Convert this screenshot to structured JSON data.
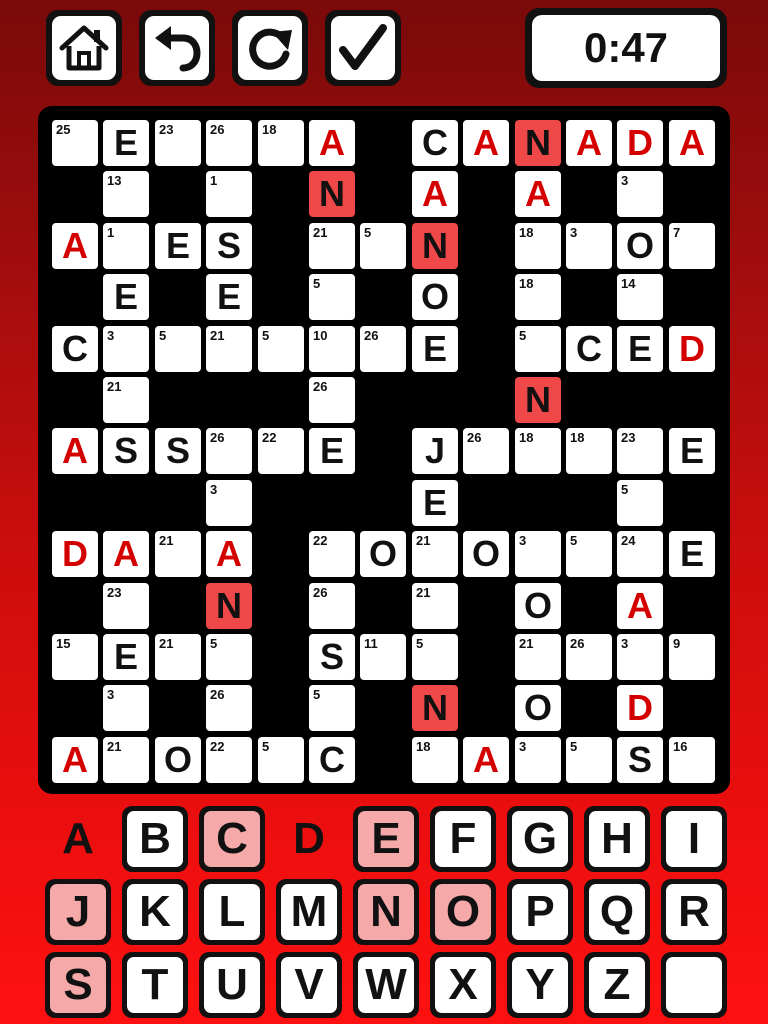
{
  "toolbar": {
    "home": "home-icon",
    "undo": "undo-icon",
    "restart": "restart-icon",
    "check": "check-icon"
  },
  "timer": "0:47",
  "grid": [
    [
      {
        "n": "25"
      },
      {
        "l": "E"
      },
      {
        "n": "23"
      },
      {
        "n": "26"
      },
      {
        "n": "18"
      },
      {
        "l": "A",
        "s": "red"
      },
      null,
      {
        "l": "C"
      },
      {
        "l": "A",
        "s": "red"
      },
      {
        "l": "N",
        "s": "fill"
      },
      {
        "l": "A",
        "s": "red"
      },
      {
        "l": "D",
        "s": "red"
      },
      {
        "l": "A",
        "s": "red"
      }
    ],
    [
      null,
      {
        "n": "13"
      },
      null,
      {
        "n": "1"
      },
      null,
      {
        "l": "N",
        "s": "fill"
      },
      null,
      {
        "l": "A",
        "s": "red"
      },
      null,
      {
        "l": "A",
        "s": "red"
      },
      null,
      {
        "n": "3"
      },
      null
    ],
    [
      {
        "l": "A",
        "s": "red"
      },
      {
        "n": "1"
      },
      {
        "l": "E"
      },
      {
        "l": "S"
      },
      null,
      {
        "n": "21"
      },
      {
        "n": "5"
      },
      {
        "l": "N",
        "s": "fill"
      },
      null,
      {
        "n": "18"
      },
      {
        "n": "3"
      },
      {
        "l": "O"
      },
      {
        "n": "7"
      }
    ],
    [
      null,
      {
        "l": "E"
      },
      null,
      {
        "l": "E"
      },
      null,
      {
        "n": "5"
      },
      null,
      {
        "l": "O"
      },
      null,
      {
        "n": "18"
      },
      null,
      {
        "n": "14"
      },
      null
    ],
    [
      {
        "l": "C"
      },
      {
        "n": "3"
      },
      {
        "n": "5"
      },
      {
        "n": "21"
      },
      {
        "n": "5"
      },
      {
        "n": "10"
      },
      {
        "n": "26"
      },
      {
        "l": "E"
      },
      null,
      {
        "n": "5"
      },
      {
        "l": "C"
      },
      {
        "l": "E"
      },
      {
        "l": "D",
        "s": "red"
      }
    ],
    [
      null,
      {
        "n": "21"
      },
      null,
      null,
      null,
      {
        "n": "26"
      },
      null,
      null,
      null,
      {
        "l": "N",
        "s": "fill"
      },
      null,
      null,
      null
    ],
    [
      {
        "l": "A",
        "s": "red"
      },
      {
        "l": "S"
      },
      {
        "l": "S"
      },
      {
        "n": "26"
      },
      {
        "n": "22"
      },
      {
        "l": "E"
      },
      null,
      {
        "l": "J"
      },
      {
        "n": "26"
      },
      {
        "n": "18"
      },
      {
        "n": "18"
      },
      {
        "n": "23"
      },
      {
        "l": "E"
      }
    ],
    [
      null,
      null,
      null,
      {
        "n": "3"
      },
      null,
      null,
      null,
      {
        "l": "E"
      },
      null,
      null,
      null,
      {
        "n": "5"
      },
      null
    ],
    [
      {
        "l": "D",
        "s": "red"
      },
      {
        "l": "A",
        "s": "red"
      },
      {
        "n": "21"
      },
      {
        "l": "A",
        "s": "red"
      },
      null,
      {
        "n": "22"
      },
      {
        "l": "O"
      },
      {
        "n": "21"
      },
      {
        "l": "O"
      },
      {
        "n": "3"
      },
      {
        "n": "5"
      },
      {
        "n": "24"
      },
      {
        "l": "E"
      }
    ],
    [
      null,
      {
        "n": "23"
      },
      null,
      {
        "l": "N",
        "s": "fill"
      },
      null,
      {
        "n": "26"
      },
      null,
      {
        "n": "21"
      },
      null,
      {
        "l": "O"
      },
      null,
      {
        "l": "A",
        "s": "red"
      },
      null
    ],
    [
      {
        "n": "15"
      },
      {
        "l": "E"
      },
      {
        "n": "21"
      },
      {
        "n": "5"
      },
      null,
      {
        "l": "S"
      },
      {
        "n": "11"
      },
      {
        "n": "5"
      },
      null,
      {
        "n": "21"
      },
      {
        "n": "26"
      },
      {
        "n": "3"
      },
      {
        "n": "9"
      }
    ],
    [
      null,
      {
        "n": "3"
      },
      null,
      {
        "n": "26"
      },
      null,
      {
        "n": "5"
      },
      null,
      {
        "l": "N",
        "s": "fill"
      },
      null,
      {
        "l": "O"
      },
      null,
      {
        "l": "D",
        "s": "red"
      },
      null
    ],
    [
      {
        "l": "A",
        "s": "red"
      },
      {
        "n": "21"
      },
      {
        "l": "O"
      },
      {
        "n": "22"
      },
      {
        "n": "5"
      },
      {
        "l": "C"
      },
      null,
      {
        "n": "18"
      },
      {
        "l": "A",
        "s": "red"
      },
      {
        "n": "3"
      },
      {
        "n": "5"
      },
      {
        "l": "S"
      },
      {
        "n": "16"
      }
    ]
  ],
  "keyboard": [
    [
      {
        "k": "A",
        "st": "placed"
      },
      {
        "k": "B"
      },
      {
        "k": "C",
        "st": "used"
      },
      {
        "k": "D",
        "st": "placed"
      },
      {
        "k": "E",
        "st": "used"
      },
      {
        "k": "F"
      },
      {
        "k": "G"
      },
      {
        "k": "H"
      },
      {
        "k": "I"
      }
    ],
    [
      {
        "k": "J",
        "st": "used"
      },
      {
        "k": "K"
      },
      {
        "k": "L"
      },
      {
        "k": "M"
      },
      {
        "k": "N",
        "st": "used"
      },
      {
        "k": "O",
        "st": "used"
      },
      {
        "k": "P"
      },
      {
        "k": "Q"
      },
      {
        "k": "R"
      }
    ],
    [
      {
        "k": "S",
        "st": "used"
      },
      {
        "k": "T"
      },
      {
        "k": "U"
      },
      {
        "k": "V"
      },
      {
        "k": "W"
      },
      {
        "k": "X"
      },
      {
        "k": "Y"
      },
      {
        "k": "Z"
      },
      {
        "k": ""
      }
    ]
  ]
}
